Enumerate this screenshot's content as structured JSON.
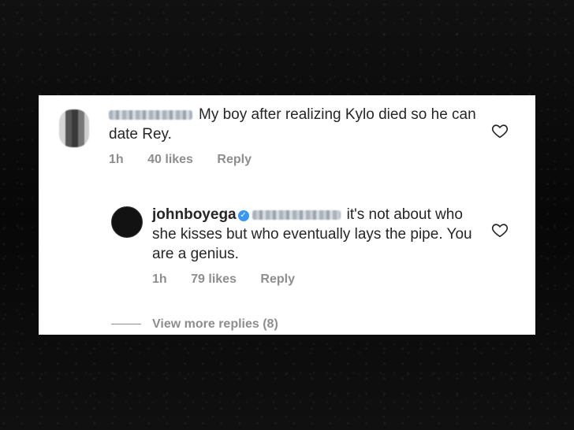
{
  "comments": [
    {
      "text": "My boy after realizing Kylo died so he can date Rey.",
      "time": "1h",
      "likes": "40 likes",
      "reply": "Reply"
    },
    {
      "username": "johnboyega",
      "verified_mark": "✓",
      "text": "it's not about who she kisses but who eventually lays the pipe. You are a genius.",
      "time": "1h",
      "likes": "79 likes",
      "reply": "Reply"
    }
  ],
  "view_more": "View more replies (8)",
  "colors": {
    "verified": "#3897f0",
    "meta": "#8e8e8e",
    "text": "#262626"
  }
}
